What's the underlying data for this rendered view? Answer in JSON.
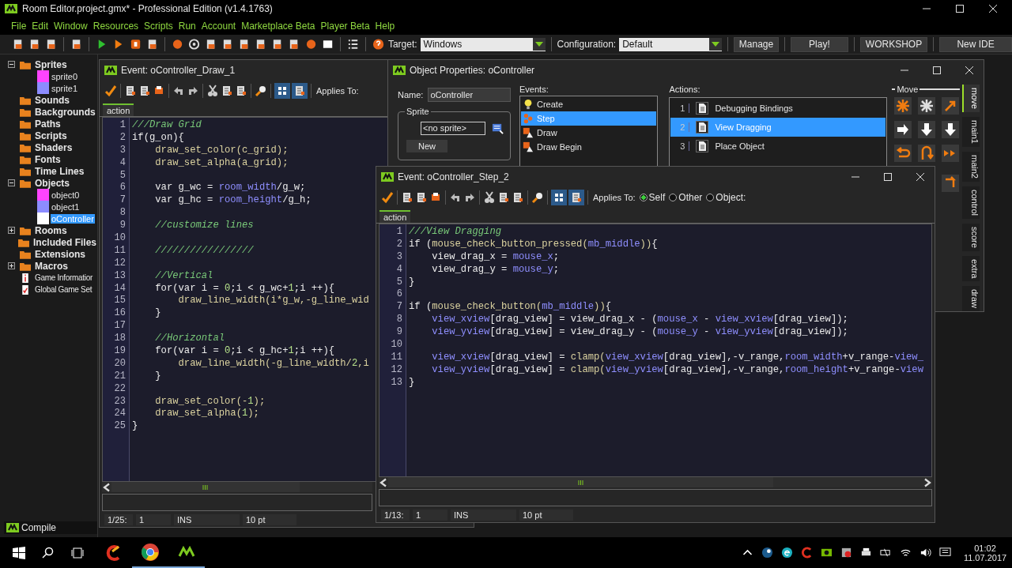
{
  "app": {
    "title": "Room Editor.project.gmx*  -  Professional Edition (v1.4.1763)"
  },
  "menu": [
    "File",
    "Edit",
    "Window",
    "Resources",
    "Scripts",
    "Run",
    "Account",
    "Marketplace Beta",
    "Player Beta",
    "Help"
  ],
  "toolbar": {
    "target_label": "Target:",
    "target": "Windows",
    "config_label": "Configuration:",
    "config": "Default",
    "buttons": [
      "Manage",
      "Play!",
      "WORKSHOP",
      "New IDE"
    ]
  },
  "resource_tree": [
    {
      "label": "Sprites",
      "kind": "group",
      "expanded": true,
      "selected": false,
      "children": [
        {
          "label": "sprite0",
          "color": "#ff44ff",
          "selected": false
        },
        {
          "label": "sprite1",
          "color": "#8c8cff",
          "selected": false
        }
      ]
    },
    {
      "label": "Sounds",
      "kind": "folder",
      "selected": false
    },
    {
      "label": "Backgrounds",
      "kind": "folder",
      "selected": false
    },
    {
      "label": "Paths",
      "kind": "folder",
      "selected": false
    },
    {
      "label": "Scripts",
      "kind": "folder",
      "selected": false
    },
    {
      "label": "Shaders",
      "kind": "folder",
      "selected": false
    },
    {
      "label": "Fonts",
      "kind": "folder",
      "selected": false
    },
    {
      "label": "Time Lines",
      "kind": "folder",
      "selected": false
    },
    {
      "label": "Objects",
      "kind": "group",
      "expanded": true,
      "selected": false,
      "children": [
        {
          "label": "object0",
          "color": "#ff44ff",
          "selected": false
        },
        {
          "label": "object1",
          "color": "#8c8cff",
          "selected": false
        },
        {
          "label": "oController",
          "color": "#ffffff",
          "selected": true
        }
      ]
    },
    {
      "label": "Rooms",
      "kind": "group",
      "expanded": false,
      "selected": false
    },
    {
      "label": "Included Files",
      "kind": "folder",
      "selected": false
    },
    {
      "label": "Extensions",
      "kind": "folder",
      "selected": false
    },
    {
      "label": "Macros",
      "kind": "group",
      "expanded": false,
      "selected": false
    },
    {
      "label": "Game Informatior",
      "kind": "info",
      "selected": false
    },
    {
      "label": "Global Game Set",
      "kind": "settings",
      "selected": false
    }
  ],
  "draw_editor": {
    "title": "Event: oController_Draw_1",
    "applies_label": "Applies To:",
    "tab": "action",
    "status": [
      "1/25:",
      "1",
      "INS",
      "10 pt"
    ],
    "lines": [
      {
        "n": "1",
        "segs": [
          {
            "text": "///Draw Grid",
            "kind": "comment"
          }
        ]
      },
      {
        "n": "2",
        "segs": [
          {
            "text": "if(g_on){",
            "kind": "plain"
          }
        ]
      },
      {
        "n": "3",
        "segs": [
          {
            "text": "    draw_set_color(c_grid);",
            "kind": "function"
          }
        ]
      },
      {
        "n": "4",
        "segs": [
          {
            "text": "    draw_set_alpha(a_grid);",
            "kind": "function"
          }
        ]
      },
      {
        "n": "5"
      },
      {
        "n": "6",
        "segs": [
          {
            "text": "    var g_wc = ",
            "kind": "plain"
          },
          {
            "text": "room_width",
            "kind": "builtin"
          },
          {
            "text": "/g_w;",
            "kind": "plain"
          }
        ]
      },
      {
        "n": "7",
        "segs": [
          {
            "text": "    var g_hc = ",
            "kind": "plain"
          },
          {
            "text": "room_height",
            "kind": "builtin"
          },
          {
            "text": "/g_h;",
            "kind": "plain"
          }
        ]
      },
      {
        "n": "8"
      },
      {
        "n": "9",
        "segs": [
          {
            "text": "    //customize lines",
            "kind": "comment"
          }
        ]
      },
      {
        "n": "10"
      },
      {
        "n": "11",
        "segs": [
          {
            "text": "    /////////////////",
            "kind": "comment"
          }
        ]
      },
      {
        "n": "12"
      },
      {
        "n": "13",
        "segs": [
          {
            "text": "    //Vertical",
            "kind": "comment"
          }
        ]
      },
      {
        "n": "14",
        "segs": [
          {
            "text": "    for(var i = ",
            "kind": "plain"
          },
          {
            "text": "0",
            "kind": "number"
          },
          {
            "text": ";i < g_wc+",
            "kind": "plain"
          },
          {
            "text": "1",
            "kind": "number"
          },
          {
            "text": ";i ++){",
            "kind": "plain"
          }
        ]
      },
      {
        "n": "15",
        "segs": [
          {
            "text": "        draw_line_width(i*g_w,-g_line_wid",
            "kind": "function"
          }
        ]
      },
      {
        "n": "16",
        "segs": [
          {
            "text": "    }",
            "kind": "plain"
          }
        ]
      },
      {
        "n": "17"
      },
      {
        "n": "18",
        "segs": [
          {
            "text": "    //Horizontal",
            "kind": "comment"
          }
        ]
      },
      {
        "n": "19",
        "segs": [
          {
            "text": "    for(var i = ",
            "kind": "plain"
          },
          {
            "text": "0",
            "kind": "number"
          },
          {
            "text": ";i < g_hc+",
            "kind": "plain"
          },
          {
            "text": "1",
            "kind": "number"
          },
          {
            "text": ";i ++){",
            "kind": "plain"
          }
        ]
      },
      {
        "n": "20",
        "segs": [
          {
            "text": "        draw_line_width(-g_line_width/",
            "kind": "function"
          },
          {
            "text": "2",
            "kind": "number"
          },
          {
            "text": ",i",
            "kind": "function"
          }
        ]
      },
      {
        "n": "21",
        "segs": [
          {
            "text": "    }",
            "kind": "plain"
          }
        ]
      },
      {
        "n": "22"
      },
      {
        "n": "23",
        "segs": [
          {
            "text": "    draw_set_color(-",
            "kind": "function"
          },
          {
            "text": "1",
            "kind": "number"
          },
          {
            "text": ");",
            "kind": "function"
          }
        ]
      },
      {
        "n": "24",
        "segs": [
          {
            "text": "    draw_set_alpha(",
            "kind": "function"
          },
          {
            "text": "1",
            "kind": "number"
          },
          {
            "text": ");",
            "kind": "function"
          }
        ]
      },
      {
        "n": "25",
        "segs": [
          {
            "text": "}",
            "kind": "plain"
          }
        ]
      }
    ]
  },
  "object_properties": {
    "title": "Object Properties: oController",
    "name_label": "Name:",
    "name": "oController",
    "sprite_group": "Sprite",
    "sprite": "<no sprite>",
    "new_button": "New",
    "events_label": "Events:",
    "events": [
      {
        "label": "Create",
        "kind": "create",
        "selected": false
      },
      {
        "label": "Step",
        "kind": "step",
        "selected": true
      },
      {
        "label": "Draw",
        "kind": "draw",
        "selected": false
      },
      {
        "label": "Draw Begin",
        "kind": "draw",
        "selected": false
      }
    ],
    "actions_label": "Actions:",
    "actions": [
      {
        "n": "1",
        "label": "Debugging Bindings",
        "selected": false
      },
      {
        "n": "2",
        "label": "View Dragging",
        "selected": true
      },
      {
        "n": "3",
        "label": "Place Object",
        "selected": false
      }
    ],
    "group_label": "Move",
    "side_tabs": [
      {
        "label": "move",
        "selected": true
      },
      {
        "label": "main1",
        "selected": false
      },
      {
        "label": "main2",
        "selected": false
      },
      {
        "label": "control",
        "selected": false
      },
      {
        "label": "score",
        "selected": false
      },
      {
        "label": "extra",
        "selected": false
      },
      {
        "label": "draw",
        "selected": false
      }
    ]
  },
  "step_editor": {
    "title": "Event: oController_Step_2",
    "applies_label": "Applies To:",
    "applies_options": [
      {
        "label": "Self",
        "selected": true
      },
      {
        "label": "Other",
        "selected": false
      },
      {
        "label": "Object:",
        "selected": false
      }
    ],
    "tab": "action",
    "status": [
      "1/13:",
      "1",
      "INS",
      "10 pt"
    ],
    "lines": [
      {
        "n": "1",
        "segs": [
          {
            "text": "///View Dragging",
            "kind": "comment"
          }
        ]
      },
      {
        "n": "2",
        "segs": [
          {
            "text": "if (",
            "kind": "plain"
          },
          {
            "text": "mouse_check_button_pressed(",
            "kind": "function"
          },
          {
            "text": "mb_middle",
            "kind": "builtin"
          },
          {
            "text": "))",
            "kind": "function"
          },
          {
            "text": "{",
            "kind": "plain"
          }
        ]
      },
      {
        "n": "3",
        "segs": [
          {
            "text": "    view_drag_x = ",
            "kind": "plain"
          },
          {
            "text": "mouse_x",
            "kind": "builtin"
          },
          {
            "text": ";",
            "kind": "plain"
          }
        ]
      },
      {
        "n": "4",
        "segs": [
          {
            "text": "    view_drag_y = ",
            "kind": "plain"
          },
          {
            "text": "mouse_y",
            "kind": "builtin"
          },
          {
            "text": ";",
            "kind": "plain"
          }
        ]
      },
      {
        "n": "5",
        "segs": [
          {
            "text": "}",
            "kind": "plain"
          }
        ]
      },
      {
        "n": "6"
      },
      {
        "n": "7",
        "segs": [
          {
            "text": "if (",
            "kind": "plain"
          },
          {
            "text": "mouse_check_button(",
            "kind": "function"
          },
          {
            "text": "mb_middle",
            "kind": "builtin"
          },
          {
            "text": "))",
            "kind": "function"
          },
          {
            "text": "{",
            "kind": "plain"
          }
        ]
      },
      {
        "n": "8",
        "indented": true,
        "segs": [
          {
            "text": "view_xview",
            "kind": "builtin"
          },
          {
            "text": "[drag_view] = view_drag_x - (",
            "kind": "plain"
          },
          {
            "text": "mouse_x",
            "kind": "builtin"
          },
          {
            "text": " - ",
            "kind": "plain"
          },
          {
            "text": "view_xview",
            "kind": "builtin"
          },
          {
            "text": "[drag_view]);",
            "kind": "plain"
          }
        ]
      },
      {
        "n": "9",
        "indented": true,
        "segs": [
          {
            "text": "view_yview",
            "kind": "builtin"
          },
          {
            "text": "[drag_view] = view_drag_y - (",
            "kind": "plain"
          },
          {
            "text": "mouse_y",
            "kind": "builtin"
          },
          {
            "text": " - ",
            "kind": "plain"
          },
          {
            "text": "view_yview",
            "kind": "builtin"
          },
          {
            "text": "[drag_view]);",
            "kind": "plain"
          }
        ]
      },
      {
        "n": "10"
      },
      {
        "n": "11",
        "indented": true,
        "segs": [
          {
            "text": "view_xview",
            "kind": "builtin"
          },
          {
            "text": "[drag_view] = ",
            "kind": "plain"
          },
          {
            "text": "clamp(",
            "kind": "function"
          },
          {
            "text": "view_xview",
            "kind": "builtin"
          },
          {
            "text": "[drag_view],-v_range,",
            "kind": "plain"
          },
          {
            "text": "room_width",
            "kind": "builtin"
          },
          {
            "text": "+v_range-",
            "kind": "plain"
          },
          {
            "text": "view_",
            "kind": "builtin"
          }
        ]
      },
      {
        "n": "12",
        "indented": true,
        "segs": [
          {
            "text": "view_yview",
            "kind": "builtin"
          },
          {
            "text": "[drag_view] = ",
            "kind": "plain"
          },
          {
            "text": "clamp(",
            "kind": "function"
          },
          {
            "text": "view_yview",
            "kind": "builtin"
          },
          {
            "text": "[drag_view],-v_range,",
            "kind": "plain"
          },
          {
            "text": "room_height",
            "kind": "builtin"
          },
          {
            "text": "+v_range-",
            "kind": "plain"
          },
          {
            "text": "view",
            "kind": "builtin"
          }
        ]
      },
      {
        "n": "13",
        "segs": [
          {
            "text": "}",
            "kind": "plain"
          }
        ]
      }
    ]
  },
  "minimized": {
    "title": "Compile"
  },
  "taskbar": {
    "time": "01:02",
    "date": "11.07.2017"
  }
}
